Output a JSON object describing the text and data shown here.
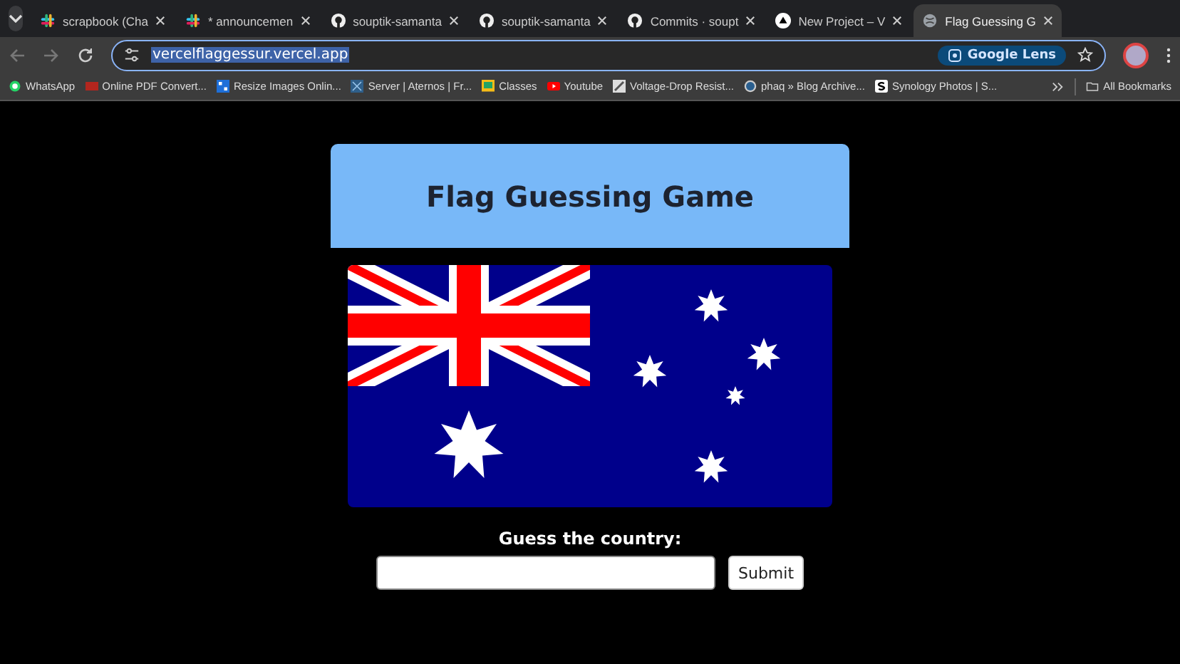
{
  "tabs": [
    {
      "title": "scrapbook (Cha",
      "kind": "slack",
      "selected": false
    },
    {
      "title": "* announcemen",
      "kind": "slack",
      "selected": false
    },
    {
      "title": "souptik-samanta",
      "kind": "github",
      "selected": false
    },
    {
      "title": "souptik-samanta",
      "kind": "github",
      "selected": false
    },
    {
      "title": "Commits · soupt",
      "kind": "github",
      "selected": false
    },
    {
      "title": "New Project – V",
      "kind": "vercel",
      "selected": false
    },
    {
      "title": "Flag Guessing G",
      "kind": "globe",
      "selected": true
    }
  ],
  "address_bar": {
    "url": "vercelflaggessur.vercel.app",
    "lens_label": "Google Lens"
  },
  "bookmarks": [
    {
      "label": "WhatsApp",
      "kind": "whatsapp"
    },
    {
      "label": "Online PDF Convert...",
      "kind": "pdf"
    },
    {
      "label": "Resize Images Onlin...",
      "kind": "resize"
    },
    {
      "label": "Server | Aternos | Fr...",
      "kind": "aternos"
    },
    {
      "label": "Classes",
      "kind": "classroom"
    },
    {
      "label": "Youtube",
      "kind": "youtube"
    },
    {
      "label": "Voltage-Drop Resist...",
      "kind": "pencil"
    },
    {
      "label": "phaq » Blog Archive...",
      "kind": "wordpress"
    },
    {
      "label": "Synology Photos | S...",
      "kind": "s"
    }
  ],
  "all_bookmarks": "All Bookmarks",
  "game": {
    "title": "Flag Guessing Game",
    "prompt": "Guess the country:",
    "submit": "Submit"
  }
}
